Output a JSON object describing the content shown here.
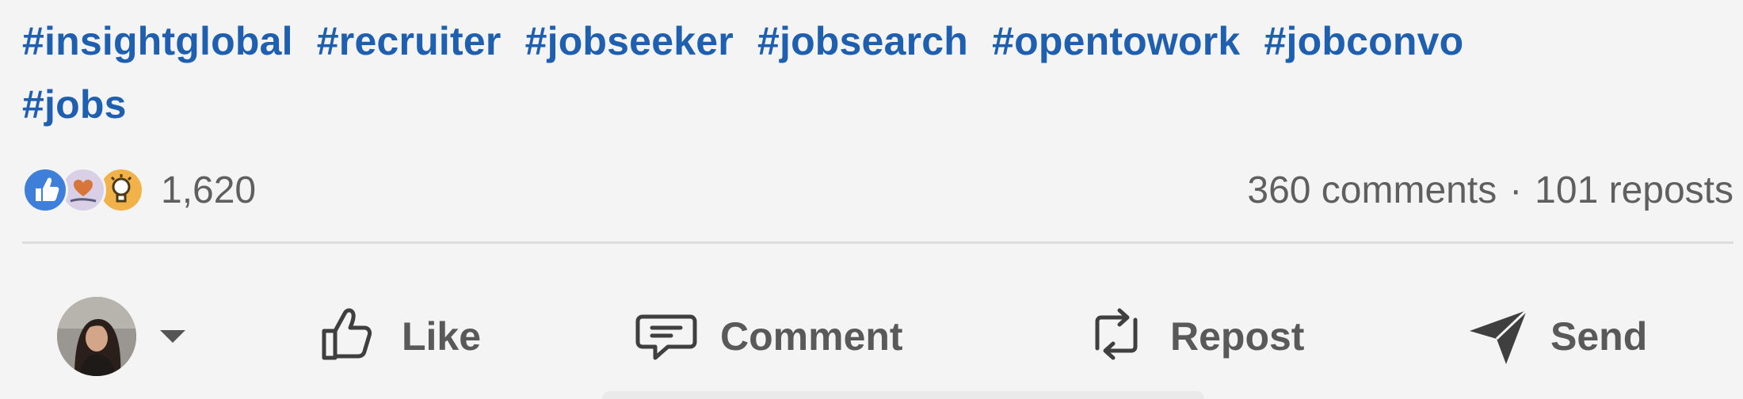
{
  "post": {
    "hashtags": [
      "#insightglobal",
      "#recruiter",
      "#jobseeker",
      "#jobsearch",
      "#opentowork",
      "#jobconvo",
      "#jobs"
    ]
  },
  "social_counts": {
    "reactions_count": "1,620",
    "comments": "360 comments",
    "separator": "·",
    "reposts": "101 reposts",
    "reaction_types": [
      "like-icon",
      "love-icon",
      "insightful-icon"
    ]
  },
  "actions": {
    "like": "Like",
    "comment": "Comment",
    "repost": "Repost",
    "send": "Send"
  },
  "colors": {
    "hashtag": "#1f5fb0",
    "text_muted": "#5f5f5f",
    "background": "#f4f4f4",
    "like_reaction": "#3d7fd9",
    "insight_reaction": "#f2b24a"
  }
}
